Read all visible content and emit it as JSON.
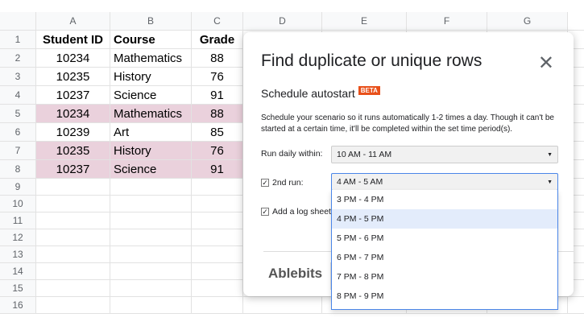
{
  "sheet": {
    "columns": [
      "A",
      "B",
      "C",
      "D",
      "E",
      "F",
      "G"
    ],
    "header": [
      "Student ID",
      "Course",
      "Grade"
    ],
    "rows": [
      [
        "10234",
        "Mathematics",
        "88"
      ],
      [
        "10235",
        "History",
        "76"
      ],
      [
        "10237",
        "Science",
        "91"
      ],
      [
        "10234",
        "Mathematics",
        "88"
      ],
      [
        "10239",
        "Art",
        "85"
      ],
      [
        "10235",
        "History",
        "76"
      ],
      [
        "10237",
        "Science",
        "91"
      ]
    ],
    "row_numbers": [
      "1",
      "2",
      "3",
      "4",
      "5",
      "6",
      "7",
      "8",
      "9",
      "10",
      "11",
      "12",
      "13",
      "14",
      "15",
      "16"
    ],
    "highlight_color": "#ead1dc"
  },
  "dialog": {
    "title": "Find duplicate or unique rows",
    "close_icon": "close-icon",
    "section": "Schedule autostart",
    "badge": "BETA",
    "description": "Schedule your scenario so it runs automatically 1-2 times a day. Though it can't be started at a certain time, it'll be completed within the set time period(s).",
    "run_daily_label": "Run daily within:",
    "run_daily_value": "10 AM - 11 AM",
    "second_run_label": "2nd run:",
    "second_run_value": "4 AM - 5 AM",
    "log_sheet_label": "Add a log sheet",
    "logo": "Ablebits",
    "options": [
      "3 PM - 4 PM",
      "4 PM - 5 PM",
      "5 PM - 6 PM",
      "6 PM - 7 PM",
      "7 PM - 8 PM",
      "8 PM - 9 PM"
    ]
  }
}
